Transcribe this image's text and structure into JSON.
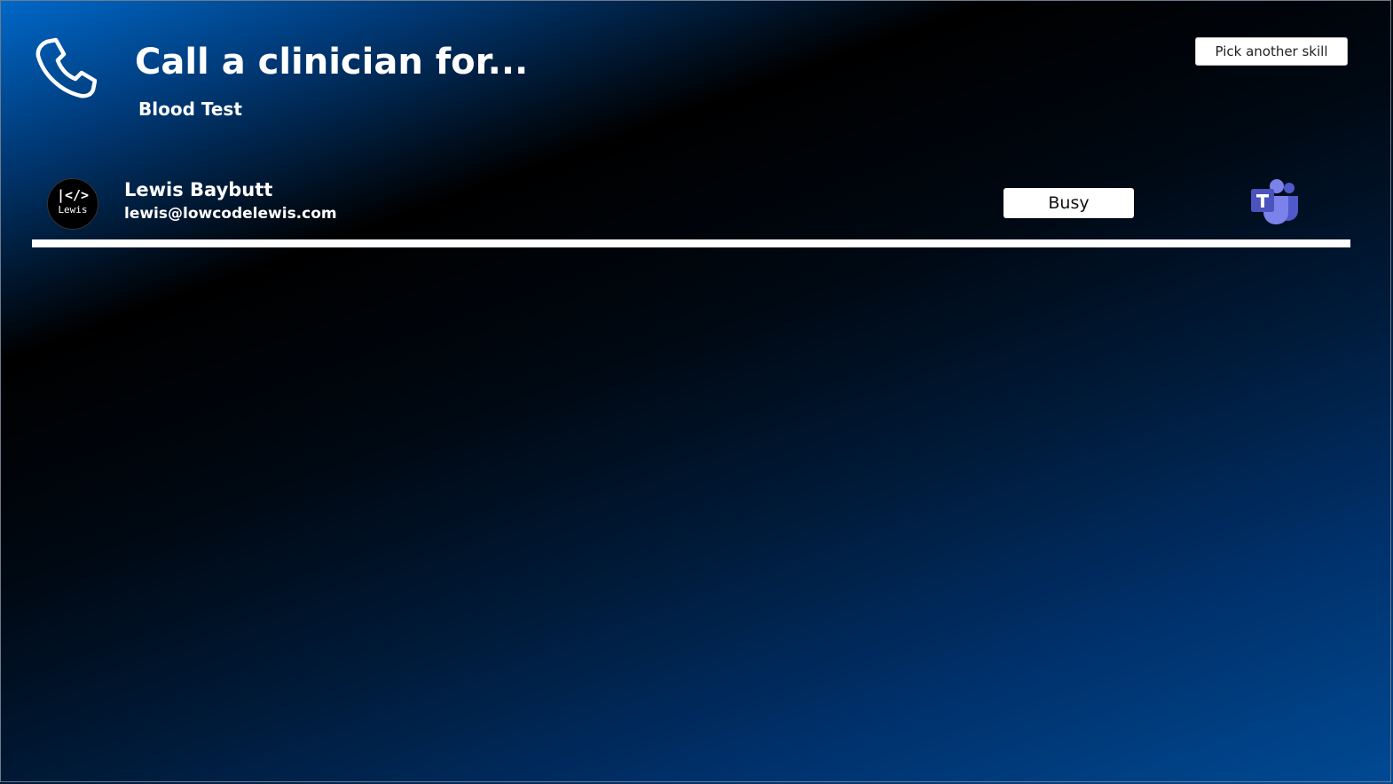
{
  "header": {
    "title": "Call a clinician for...",
    "skill": "Blood Test",
    "pick_button_label": "Pick another skill",
    "icon": "phone-icon"
  },
  "clinicians": [
    {
      "avatar_code": "|</>",
      "avatar_name": "Lewis",
      "name": "Lewis Baybutt",
      "email": "lewis@lowcodelewis.com",
      "status": "Busy",
      "action_icon": "microsoft-teams-icon"
    }
  ],
  "colors": {
    "gradient_top_left": "#0068c8",
    "gradient_mid": "#000000",
    "gradient_bottom_right": "#004a94",
    "teams_purple": "#5059c9",
    "teams_light": "#7b83eb"
  }
}
